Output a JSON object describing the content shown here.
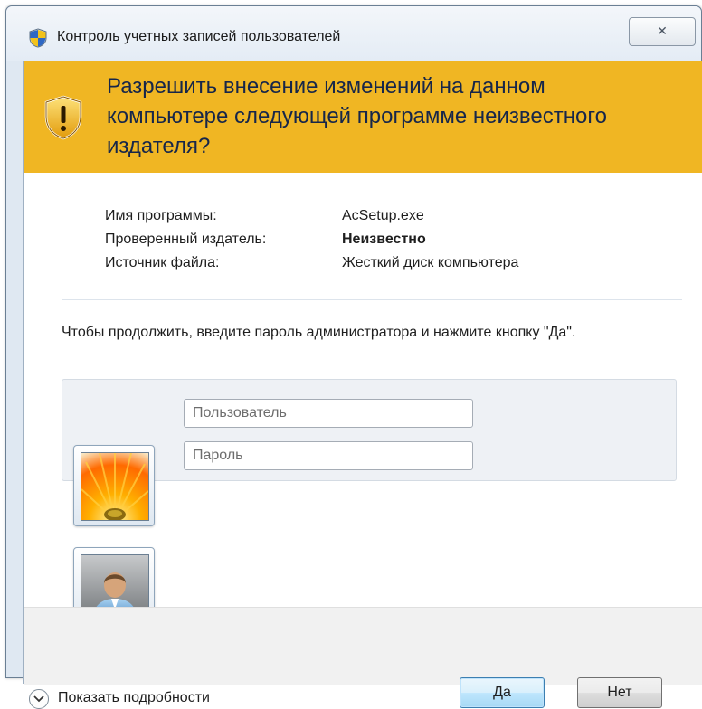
{
  "window": {
    "title": "Контроль учетных записей пользователей",
    "close_label": "✕"
  },
  "banner": {
    "question": "Разрешить внесение изменений на данном компьютере следующей программе неизвестного издателя?",
    "color": "#f0b623"
  },
  "details": {
    "rows": [
      {
        "label": "Имя программы:",
        "value": "AcSetup.exe"
      },
      {
        "label": "Проверенный издатель:",
        "value": "Неизвестно"
      },
      {
        "label": "Источник файла:",
        "value": "Жесткий диск компьютера"
      }
    ]
  },
  "prompt": "Чтобы продолжить, введите пароль администратора и нажмите кнопку \"Да\".",
  "credentials": {
    "username_placeholder": "Пользователь",
    "password_placeholder": "Пароль",
    "selected_tile_icon": "flower-avatar",
    "other_tile_icon": "user-avatar"
  },
  "footer": {
    "show_details_label": "Показать подробности",
    "yes_label": "Да",
    "no_label": "Нет"
  }
}
